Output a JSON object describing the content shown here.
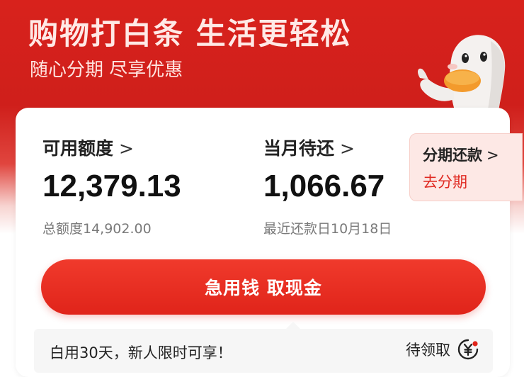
{
  "hero": {
    "title": "购物打白条 生活更轻松",
    "subtitle": "随心分期 尽享优惠"
  },
  "available": {
    "label": "可用额度",
    "amount": "12,379.13",
    "meta": "总额度14,902.00"
  },
  "due": {
    "label": "当月待还",
    "amount": "1,066.67",
    "meta": "最近还款日10月18日"
  },
  "installment": {
    "title": "分期还款",
    "action": "去分期"
  },
  "chevron": ">",
  "cta": {
    "label": "急用钱 取现金"
  },
  "promo": {
    "text": "白用30天，新人限时可享！",
    "action": "待领取",
    "icon": "yuan-coupon-icon"
  },
  "colors": {
    "brand_red": "#d8221c",
    "button_red": "#e0241a",
    "accent_text": "#e02a22",
    "installment_bg": "#fde8e5"
  }
}
